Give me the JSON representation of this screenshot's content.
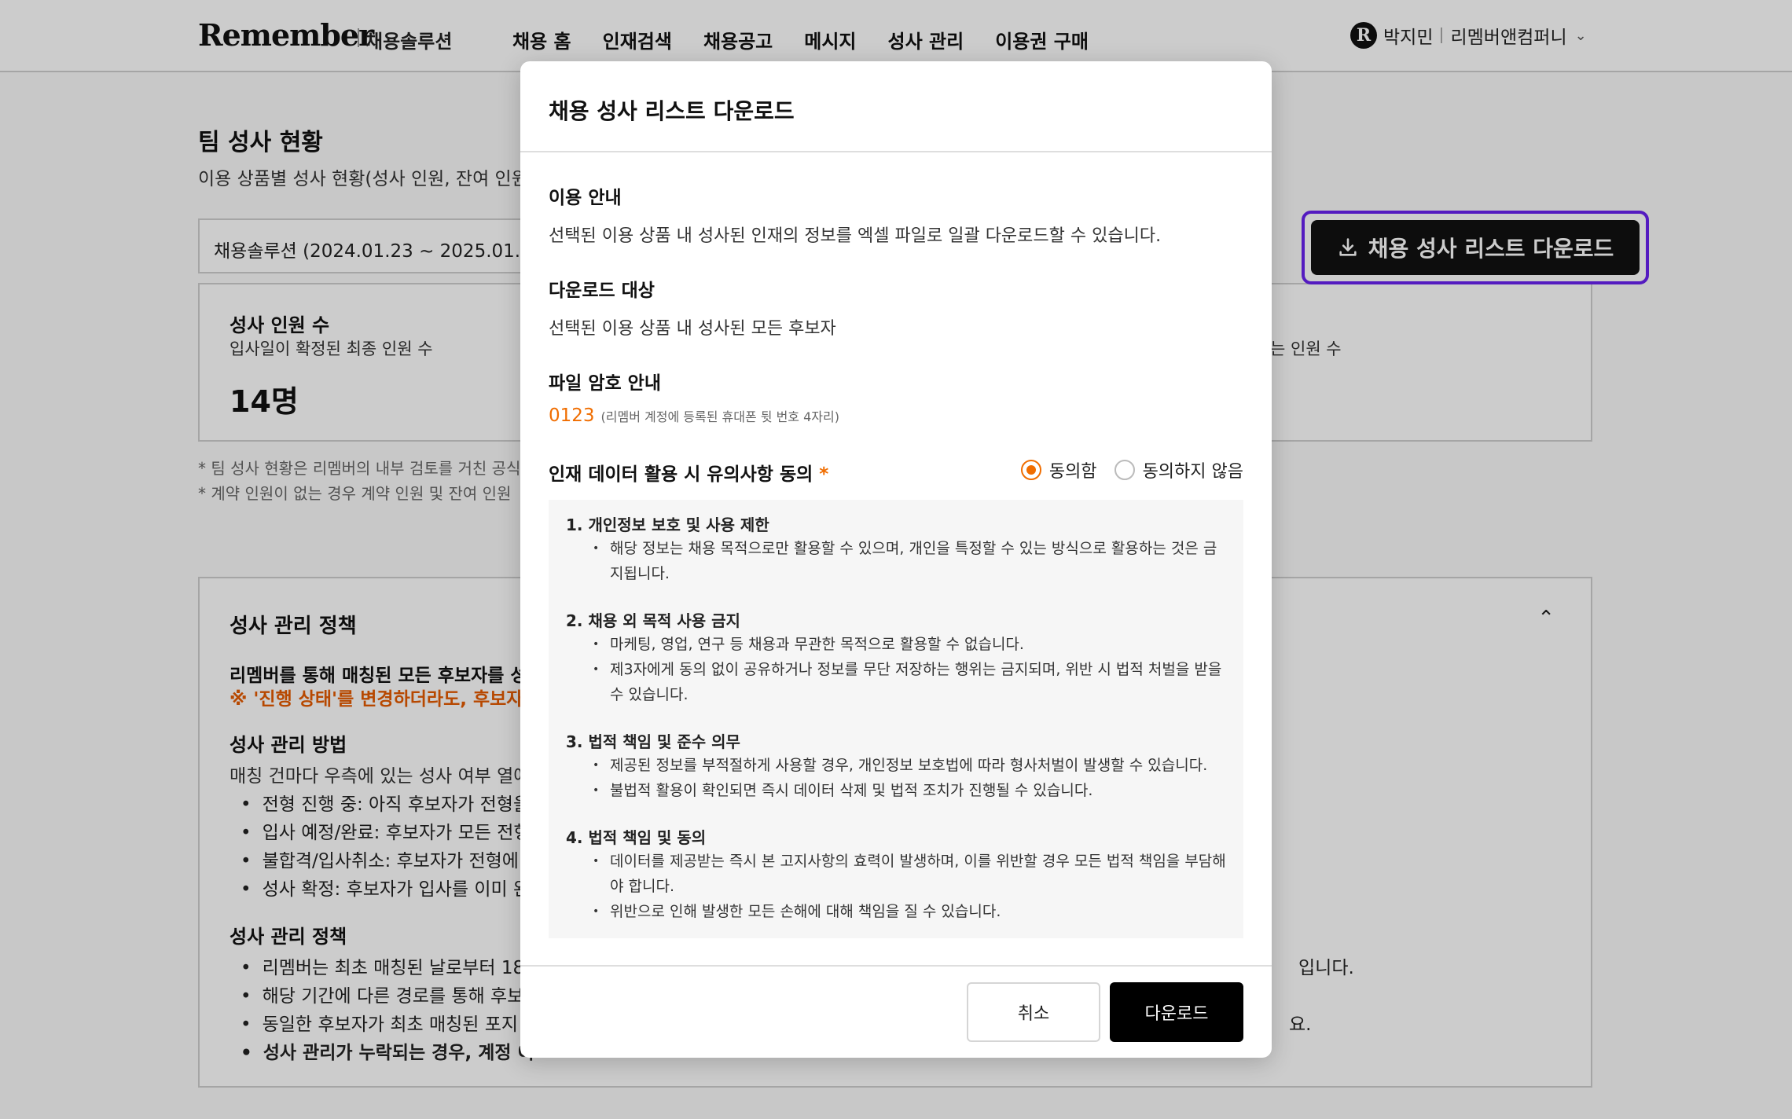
{
  "header": {
    "logo": "Remember",
    "logo_sub": "채용솔루션",
    "nav": [
      "채용 홈",
      "인재검색",
      "채용공고",
      "메시지",
      "성사 관리",
      "이용권 구매"
    ],
    "user_name": "박지민",
    "company": "리멤버앤컴퍼니"
  },
  "page": {
    "title": "팀 성사 현황",
    "desc": "이용 상품별 성사 현황(성사 인원, 잔여 인원",
    "selected_product": "채용솔루션 (2024.01.23 ~ 2025.01.2",
    "stat": {
      "title": "성사 인원 수",
      "desc": "입사일이 확정된 최종 인원 수",
      "value": "14명",
      "desc_right": "는 인원 수"
    },
    "notes": [
      "* 팀 성사 현황은 리멤버의 내부 검토를 거친 공식",
      "* 계약 인원이 없는 경우 계약 인원 및 잔여 인원"
    ],
    "download_button": "채용 성사 리스트 다운로드"
  },
  "policy": {
    "title": "성사 관리 정책",
    "strong": "리멤버를 통해 매칭된 모든 후보자를 성",
    "warning": "※ '진행 상태'를 변경하더라도, 후보자의",
    "method_title": "성사 관리 방법",
    "method_text": "매칭 건마다 우측에 있는 성사 여부 열에",
    "method_items": [
      "전형 진행 중: 아직 후보자가 전형을",
      "입사 예정/완료: 후보자가 모든 전형",
      "불합격/입사취소: 후보자가 전형에",
      "성사 확정: 후보자가 입사를 이미 완"
    ],
    "policy_title": "성사 관리 정책",
    "policy_items": [
      "리멤버는 최초 매칭된 날로부터 18",
      "해당 기간에 다른 경로를 통해 후보",
      "동일한 후보자가 최초 매칭된 포지",
      "성사 관리가 누락되는 경우, 계정 이"
    ],
    "right_fragments": [
      "입니다.",
      "요."
    ]
  },
  "modal": {
    "title": "채용 성사 리스트 다운로드",
    "usage_label": "이용 안내",
    "usage_text": "선택된 이용 상품 내 성사된 인재의 정보를 엑셀 파일로 일괄 다운로드할 수 있습니다.",
    "target_label": "다운로드 대상",
    "target_text": "선택된 이용 상품 내 성사된 모든 후보자",
    "password_label": "파일 암호 안내",
    "password_code": "0123",
    "password_hint": "(리멤버 계정에 등록된 휴대폰 뒷 번호 4자리)",
    "consent_label": "인재 데이터 활용 시 유의사항 동의",
    "consent_required": "*",
    "agree": "동의함",
    "disagree": "동의하지 않음",
    "terms": [
      {
        "heading": "1. 개인정보 보호 및 사용 제한",
        "items": [
          "해당 정보는 채용 목적으로만 활용할 수 있으며, 개인을 특정할 수 있는 방식으로 활용하는 것은 금",
          "지됩니다."
        ]
      },
      {
        "heading": "2. 채용 외 목적 사용 금지",
        "items": [
          "마케팅, 영업, 연구 등 채용과 무관한 목적으로 활용할 수 없습니다.",
          "제3자에게 동의 없이 공유하거나 정보를 무단 저장하는 행위는 금지되며, 위반 시 법적 처벌을 받을",
          "수 있습니다."
        ]
      },
      {
        "heading": "3. 법적 책임 및 준수 의무",
        "items": [
          "제공된 정보를 부적절하게 사용할 경우, 개인정보 보호법에 따라 형사처벌이 발생할 수 있습니다.",
          "불법적 활용이 확인되면 즉시 데이터 삭제 및 법적 조치가 진행될 수 있습니다."
        ]
      },
      {
        "heading": "4. 법적 책임 및 동의",
        "items": [
          "데이터를 제공받는 즉시 본 고지사항의 효력이 발생하며, 이를 위반할 경우 모든 법적 책임을 부담해",
          "야 합니다.",
          "위반으로 인해 발생한 모든 손해에 대해 책임을 질 수 있습니다."
        ]
      }
    ],
    "cancel": "취소",
    "download": "다운로드"
  },
  "colors": {
    "accent_orange": "#f06d00",
    "highlight_purple": "#6a22f0",
    "primary_black": "#000000"
  }
}
